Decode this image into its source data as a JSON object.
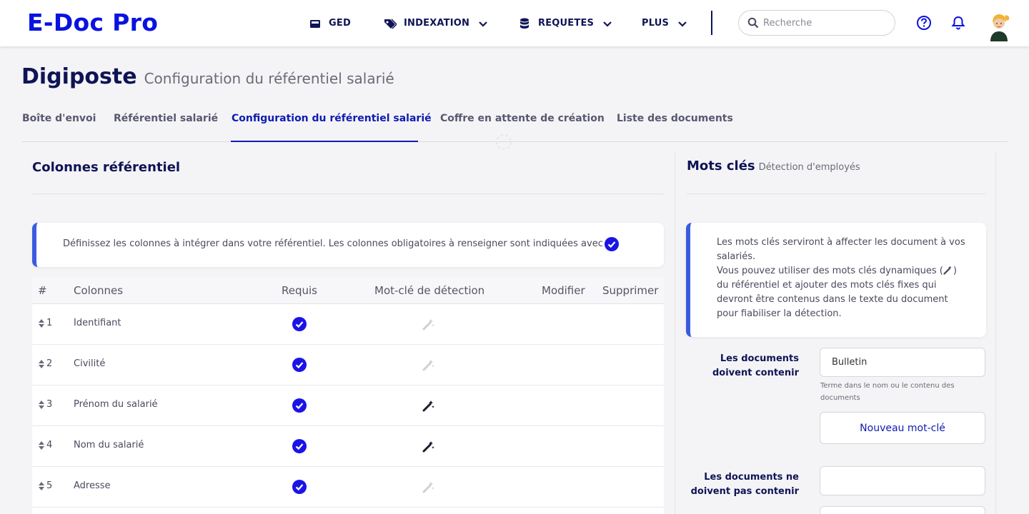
{
  "app": {
    "brand": "E-Doc Pro"
  },
  "nav": {
    "ged": "GED",
    "indexation": "INDEXATION",
    "requetes": "REQUETES",
    "plus": "PLUS",
    "search_placeholder": "Recherche"
  },
  "page": {
    "title": "Digiposte",
    "subtitle": "Configuration du référentiel salarié"
  },
  "tabs": [
    {
      "label": "Boîte d'envoi"
    },
    {
      "label": "Référentiel salarié"
    },
    {
      "label": "Configuration du référentiel salarié",
      "active": true
    },
    {
      "label": "Coffre en attente de création"
    },
    {
      "label": "Liste des documents"
    }
  ],
  "left": {
    "title": "Colonnes référentiel",
    "info": "Définissez les colonnes à intégrer dans votre référentiel. Les colonnes obligatoires à renseigner sont indiquées avec",
    "columns": {
      "num": "#",
      "name": "Colonnes",
      "required": "Requis",
      "keyword": "Mot-clé de détection",
      "edit": "Modifier",
      "delete": "Supprimer"
    },
    "rows": [
      {
        "num": "1",
        "name": "Identifiant",
        "required": true,
        "keyword_active": false
      },
      {
        "num": "2",
        "name": "Civilité",
        "required": true,
        "keyword_active": false
      },
      {
        "num": "3",
        "name": "Prénom du salarié",
        "required": true,
        "keyword_active": true
      },
      {
        "num": "4",
        "name": "Nom du salarié",
        "required": true,
        "keyword_active": true
      },
      {
        "num": "5",
        "name": "Adresse",
        "required": true,
        "keyword_active": false
      }
    ]
  },
  "right": {
    "title": "Mots clés",
    "subtitle": "Détection d'employés",
    "info_1": "Les mots clés serviront à affecter les document à vos salariés.",
    "info_2a": "Vous pouvez utiliser des mots clés dynamiques (",
    "info_2b": ") du référentiel et ajouter des mots clés fixes qui devront être contenus dans le texte du document pour fiabiliser la détection.",
    "must_contain_label": "Les documents doivent contenir",
    "must_contain_value": "Bulletin",
    "must_contain_hint": "Terme dans le nom ou le contenu des documents",
    "new_keyword_button": "Nouveau mot-clé",
    "must_not_contain_label": "Les documents ne doivent pas contenir",
    "must_not_contain_value": ""
  },
  "colors": {
    "brand": "#0a12e0",
    "navy": "#0f1455",
    "accent_blue": "#0f1bb0",
    "check_blue": "#1a14e6",
    "info_border": "#3a5be0"
  },
  "icons": {
    "ged": "folder-icon",
    "indexation": "tags-icon",
    "requetes": "database-icon",
    "search": "search-icon",
    "help": "question-circle-icon",
    "notifications": "bell-icon",
    "required": "check-circle-icon",
    "keyword": "magic-wand-icon",
    "sort": "sort-icon"
  }
}
